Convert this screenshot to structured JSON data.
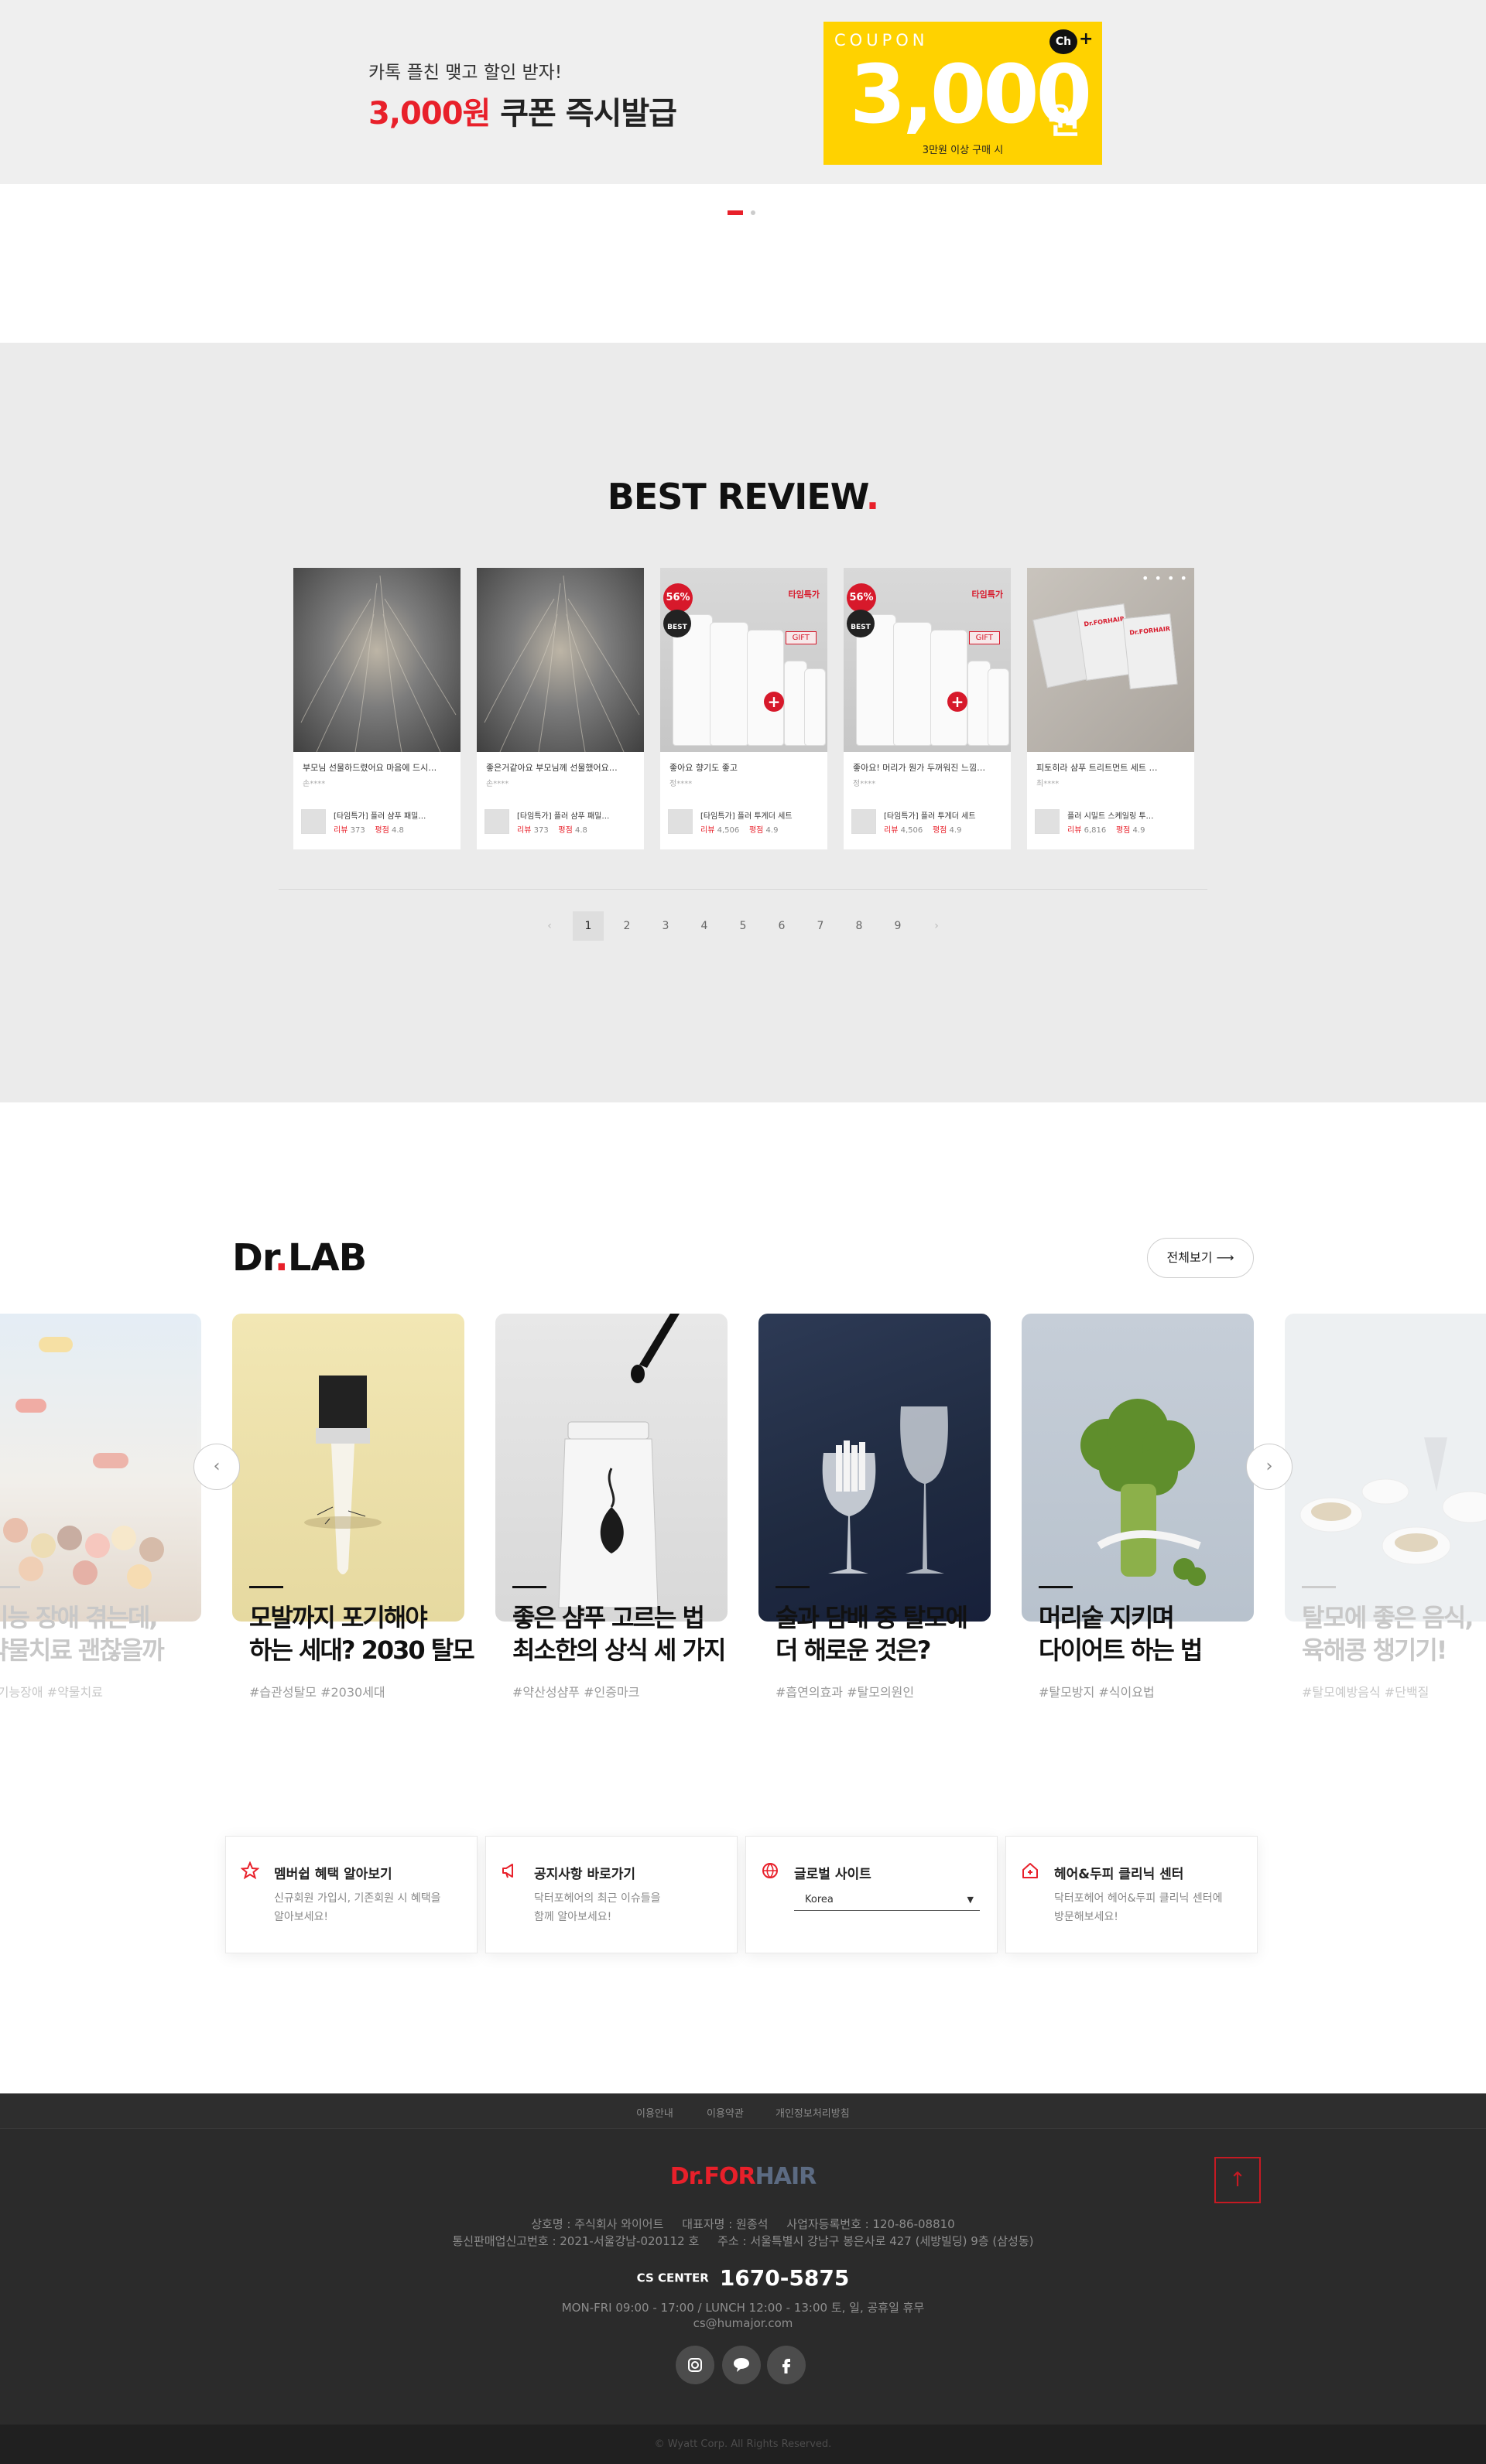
{
  "banner": {
    "subtitle": "카톡 플친 맺고 할인 받자!",
    "title_highlight": "3,000원",
    "title_rest": " 쿠폰 즉시발급",
    "coupon": {
      "label": "COUPON",
      "amount": "3,000",
      "unit": "원",
      "condition": "3만원 이상 구매 시",
      "channel": "Ch",
      "channel_plus": "+"
    },
    "slides": {
      "current": 1,
      "total": 2
    }
  },
  "best_review": {
    "title": "BEST REVIEW",
    "title_dot": ".",
    "cards": [
      {
        "text": "부모님 선물하드렸어요 마음에 드시…",
        "author": "손****",
        "product": "[타임특가] 플러 샴푸 패밀…",
        "reviews_label": "리뷰",
        "reviews": "373",
        "rating_label": "평점",
        "rating": "4.8"
      },
      {
        "text": "좋은거같아요 부모님께 선물했어요…",
        "author": "손****",
        "product": "[타임특가] 플러 샴푸 패밀…",
        "reviews_label": "리뷰",
        "reviews": "373",
        "rating_label": "평점",
        "rating": "4.8"
      },
      {
        "text": "좋아요 향기도 좋고",
        "author": "정****",
        "product": "[타임특가] 플러 투게더 세트",
        "reviews_label": "리뷰",
        "reviews": "4,506",
        "rating_label": "평점",
        "rating": "4.9",
        "badge": "56%",
        "best": "BEST",
        "brand": "타임특가",
        "gift": "GIFT"
      },
      {
        "text": "좋아요! 머리가 뭔가 두꺼워진 느낌…",
        "author": "정****",
        "product": "[타임특가] 플러 투게더 세트",
        "reviews_label": "리뷰",
        "reviews": "4,506",
        "rating_label": "평점",
        "rating": "4.9",
        "badge": "56%",
        "best": "BEST",
        "brand": "타임특가",
        "gift": "GIFT"
      },
      {
        "text": "피토히라 샴푸 트리트먼트 세트 …",
        "author": "최****",
        "product": "플러 시밀트 스케일링 투…",
        "reviews_label": "리뷰",
        "reviews": "6,816",
        "rating_label": "평점",
        "rating": "4.9",
        "sachet": "Dr.FORHAIR"
      }
    ],
    "pagination": {
      "prev": "‹",
      "pages": [
        "1",
        "2",
        "3",
        "4",
        "5",
        "6",
        "7",
        "8",
        "9"
      ],
      "current": "1",
      "next": "›"
    }
  },
  "dr_lab": {
    "title_a": "Dr",
    "title_dot": ".",
    "title_b": "LAB",
    "view_all": "전체보기 ⟶",
    "prev": "‹",
    "next": "›",
    "cards": [
      {
        "title": "기능 장애 겪는데,\n약물치료 괜찮을까",
        "tags": "장기능장애 #약물치료"
      },
      {
        "title": "모발까지 포기해야\n하는 세대? 2030 탈모",
        "tags": "#습관성탈모 #2030세대"
      },
      {
        "title": "좋은 샴푸 고르는 법\n최소한의 상식 세 가지",
        "tags": "#약산성샴푸 #인증마크"
      },
      {
        "title": "술과 담배 중 탈모에\n더 해로운 것은?",
        "tags": "#흡연의효과 #탈모의원인"
      },
      {
        "title": "머리숱 지키며\n다이어트 하는 법",
        "tags": "#탈모방지 #식이요법"
      },
      {
        "title": "탈모에 좋은 음식,\n육해콩 챙기기!",
        "tags": "#탈모예방음식 #단백질"
      }
    ]
  },
  "info_boxes": [
    {
      "title": "멤버쉽 혜택 알아보기",
      "desc": "신규회원 가입시, 기존회원 시 혜택을\n알아보세요!",
      "icon": "star-icon"
    },
    {
      "title": "공지사항 바로가기",
      "desc": "닥터포헤어의 최근 이슈들을\n함께 알아보세요!",
      "icon": "megaphone-icon"
    },
    {
      "title": "글로벌 사이트",
      "select_value": "Korea",
      "icon": "globe-icon"
    },
    {
      "title": "헤어&두피 클리닉 센터",
      "desc": "닥터포헤어 헤어&두피 클리닉 센터에\n방문해보세요!",
      "icon": "home-icon"
    }
  ],
  "footer": {
    "links": [
      "이용안내",
      "이용약관",
      "개인정보처리방침"
    ],
    "logo_a": "Dr.FOR",
    "logo_b": "HAIR",
    "top_button": "↑",
    "company_line1": "상호명 : 주식회사 와이어트     대표자명 : 원종석     사업자등록번호 : 120-86-08810",
    "company_line2": "통신판매업신고번호 : 2021-서울강남-020112 호     주소 : 서울특별시 강남구 봉은사로 427 (세방빌딩) 9층 (삼성동)",
    "cs_label": "CS CENTER",
    "cs_number": "1670-5875",
    "hours": "MON-FRI 09:00 - 17:00 / LUNCH 12:00 - 13:00 토, 일, 공휴일 휴무",
    "email": "cs@humajor.com",
    "social": [
      "instagram-icon",
      "kakao-icon",
      "facebook-icon"
    ],
    "copyright": "© Wyatt Corp. All Rights Reserved."
  },
  "colors": {
    "accent": "#e8202a",
    "coupon": "#ffd200",
    "footer_bg": "#2b2b2b"
  }
}
